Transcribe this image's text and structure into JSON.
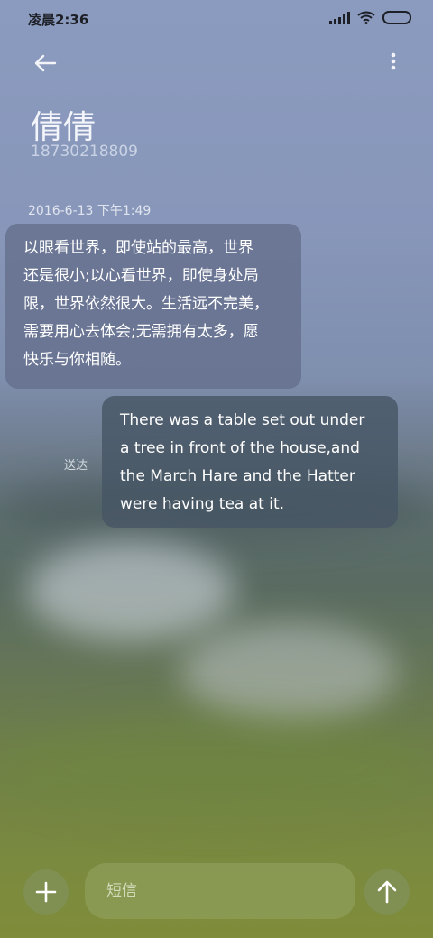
{
  "status_bar": {
    "time": "凌晨2:36",
    "icons": [
      "signal-icon",
      "wifi-icon",
      "battery-icon"
    ]
  },
  "header": {
    "back_icon": "back-arrow-icon",
    "menu_icon": "more-vertical-icon",
    "contact_name": "倩倩",
    "contact_number": "18730218809"
  },
  "thread": {
    "timestamp": "2016-6-13 下午1:49",
    "messages": [
      {
        "direction": "incoming",
        "lines": [
          "以眼看世界，即使站的最高，世界",
          "还是很小;以心看世界，即使身处局",
          "限，世界依然很大。生活远不完美，",
          "需要用心去体会;无需拥有太多，愿",
          "快乐与你相随。"
        ]
      },
      {
        "direction": "outgoing",
        "status": "送达",
        "lines": [
          "There was a table set out under",
          "a tree in front of the house,and",
          "the March Hare and the Hatter",
          "were having tea at it."
        ]
      }
    ]
  },
  "compose": {
    "add_icon": "plus-icon",
    "placeholder": "短信",
    "value": "",
    "send_icon": "send-arrow-up-icon"
  },
  "colors": {
    "bubble_in": "#6e7896",
    "bubble_out": "#4a5868",
    "text": "#ffffff"
  }
}
